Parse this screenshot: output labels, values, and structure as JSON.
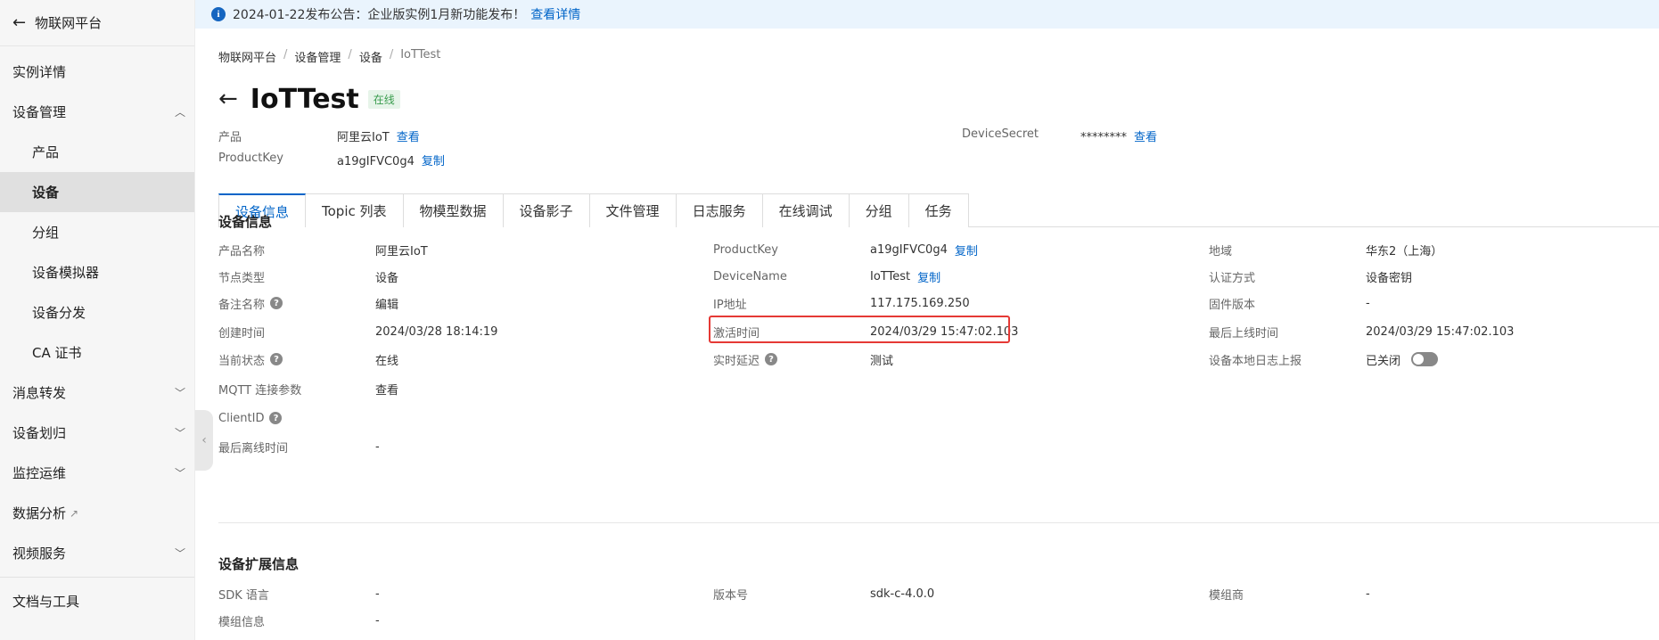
{
  "sidebar": {
    "back_label": "物联网平台",
    "items": [
      {
        "label": "实例详情"
      },
      {
        "label": "设备管理"
      },
      {
        "label": "产品"
      },
      {
        "label": "设备"
      },
      {
        "label": "分组"
      },
      {
        "label": "设备模拟器"
      },
      {
        "label": "设备分发"
      },
      {
        "label": "CA 证书"
      },
      {
        "label": "消息转发"
      },
      {
        "label": "设备划归"
      },
      {
        "label": "监控运维"
      },
      {
        "label": "数据分析"
      },
      {
        "label": "视频服务"
      },
      {
        "label": "文档与工具"
      }
    ]
  },
  "notice": {
    "text": "2024-01-22发布公告：企业版实例1月新功能发布！",
    "link": "查看详情"
  },
  "breadcrumb": [
    "物联网平台",
    "设备管理",
    "设备",
    "IoTTest"
  ],
  "page": {
    "title": "IoTTest",
    "status": "在线"
  },
  "meta": {
    "product_label": "产品",
    "product_value": "阿里云IoT",
    "product_link": "查看",
    "productkey_label": "ProductKey",
    "productkey_value": "a19gIFVC0g4",
    "productkey_link": "复制",
    "secret_label": "DeviceSecret",
    "secret_value": "********",
    "secret_link": "查看"
  },
  "tabs": [
    "设备信息",
    "Topic 列表",
    "物模型数据",
    "设备影子",
    "文件管理",
    "日志服务",
    "在线调试",
    "分组",
    "任务"
  ],
  "device_info": {
    "title": "设备信息",
    "product_name_k": "产品名称",
    "product_name_v": "阿里云IoT",
    "node_type_k": "节点类型",
    "node_type_v": "设备",
    "remark_k": "备注名称",
    "remark_v": "编辑",
    "created_k": "创建时间",
    "created_v": "2024/03/28 18:14:19",
    "state_k": "当前状态",
    "state_v": "在线",
    "mqtt_k": "MQTT 连接参数",
    "mqtt_v": "查看",
    "clientid_k": "ClientID",
    "lastoff_k": "最后离线时间",
    "lastoff_v": "-",
    "pk_k": "ProductKey",
    "pk_v": "a19gIFVC0g4",
    "pk_link": "复制",
    "dn_k": "DeviceName",
    "dn_v": "IoTTest",
    "dn_link": "复制",
    "ip_k": "IP地址",
    "ip_v": "117.175.169.250",
    "activate_k": "激活时间",
    "activate_v": "2024/03/29 15:47:02.103",
    "latency_k": "实时延迟",
    "latency_v": "测试",
    "region_k": "地域",
    "region_v": "华东2（上海）",
    "auth_k": "认证方式",
    "auth_v": "设备密钥",
    "firmware_k": "固件版本",
    "firmware_v": "-",
    "lastonline_k": "最后上线时间",
    "lastonline_v": "2024/03/29 15:47:02.103",
    "locallog_k": "设备本地日志上报",
    "locallog_v": "已关闭"
  },
  "ext_info": {
    "title": "设备扩展信息",
    "sdk_k": "SDK 语言",
    "sdk_v": "-",
    "ver_k": "版本号",
    "ver_v": "sdk-c-4.0.0",
    "vendor_k": "模组商",
    "vendor_v": "-",
    "module_k": "模组信息",
    "module_v": "-"
  },
  "colors": {
    "accent": "#0064c8",
    "highlight": "#e53935",
    "online": "#3a9c4e"
  }
}
